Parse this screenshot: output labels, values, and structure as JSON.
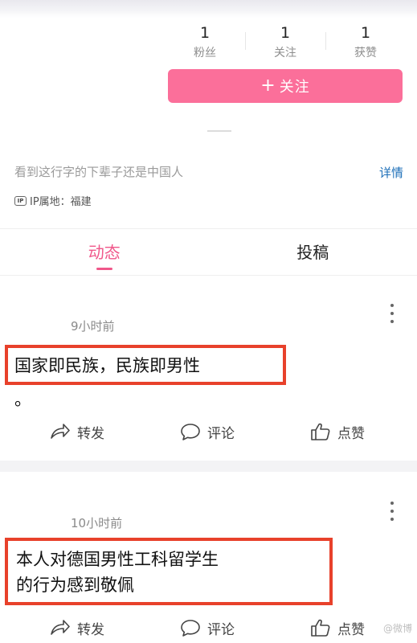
{
  "stats": [
    {
      "value": "1",
      "label": "粉丝"
    },
    {
      "value": "1",
      "label": "关注"
    },
    {
      "value": "1",
      "label": "获赞"
    }
  ],
  "follow_button": {
    "icon": "plus-icon",
    "label": "关注"
  },
  "bio": "看到这行字的下辈子还是中国人",
  "detail_link": "详情",
  "ip": {
    "icon": "ip-icon",
    "badge": "IP",
    "label": "IP属地：福建"
  },
  "tabs": [
    {
      "label": "动态",
      "active": true
    },
    {
      "label": "投稿",
      "active": false
    }
  ],
  "posts": [
    {
      "time": "9小时前",
      "lines": [
        "国家即民族，民族即男性"
      ],
      "trailing": "。"
    },
    {
      "time": "10小时前",
      "lines": [
        "本人对德国男性工科留学生",
        "的行为感到敬佩"
      ]
    }
  ],
  "actions": {
    "repost": "转发",
    "comment": "评论",
    "like": "点赞"
  },
  "colors": {
    "accent_pink": "#f0578a",
    "follow_button_bg": "#fb6f9a",
    "highlight_box": "#e8412b",
    "link_blue": "#1d6fb8"
  },
  "watermark": "@微博"
}
